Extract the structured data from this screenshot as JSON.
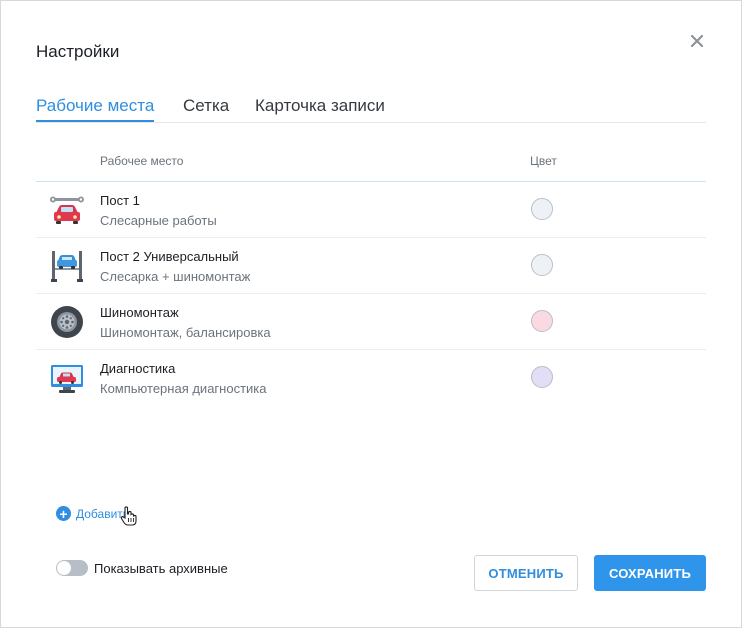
{
  "dialog": {
    "title": "Настройки"
  },
  "tabs": [
    {
      "label": "Рабочие места",
      "active": true
    },
    {
      "label": "Сетка",
      "active": false
    },
    {
      "label": "Карточка записи",
      "active": false
    }
  ],
  "table": {
    "columns": {
      "workplace": "Рабочее место",
      "color": "Цвет"
    },
    "rows": [
      {
        "name": "Пост 1",
        "description": "Слесарные работы",
        "icon": "car-repair-icon",
        "color": "#eef2f7"
      },
      {
        "name": "Пост 2 Универсальный",
        "description": "Слесарка + шиномонтаж",
        "icon": "car-lift-icon",
        "color": "#eef2f7"
      },
      {
        "name": "Шиномонтаж",
        "description": "Шиномонтаж, балансировка",
        "icon": "tire-icon",
        "color": "#fbd9e1"
      },
      {
        "name": "Диагностика",
        "description": "Компьютерная диагностика",
        "icon": "computer-diagnostics-icon",
        "color": "#e1def5"
      }
    ]
  },
  "add_link": {
    "label": "Добавить"
  },
  "archive_toggle": {
    "label": "Показывать архивные",
    "on": false
  },
  "buttons": {
    "cancel": "ОТМЕНИТЬ",
    "save": "СОХРАНИТЬ"
  },
  "colors": {
    "accent": "#2f8ee0",
    "save_button": "#2f95ea"
  }
}
